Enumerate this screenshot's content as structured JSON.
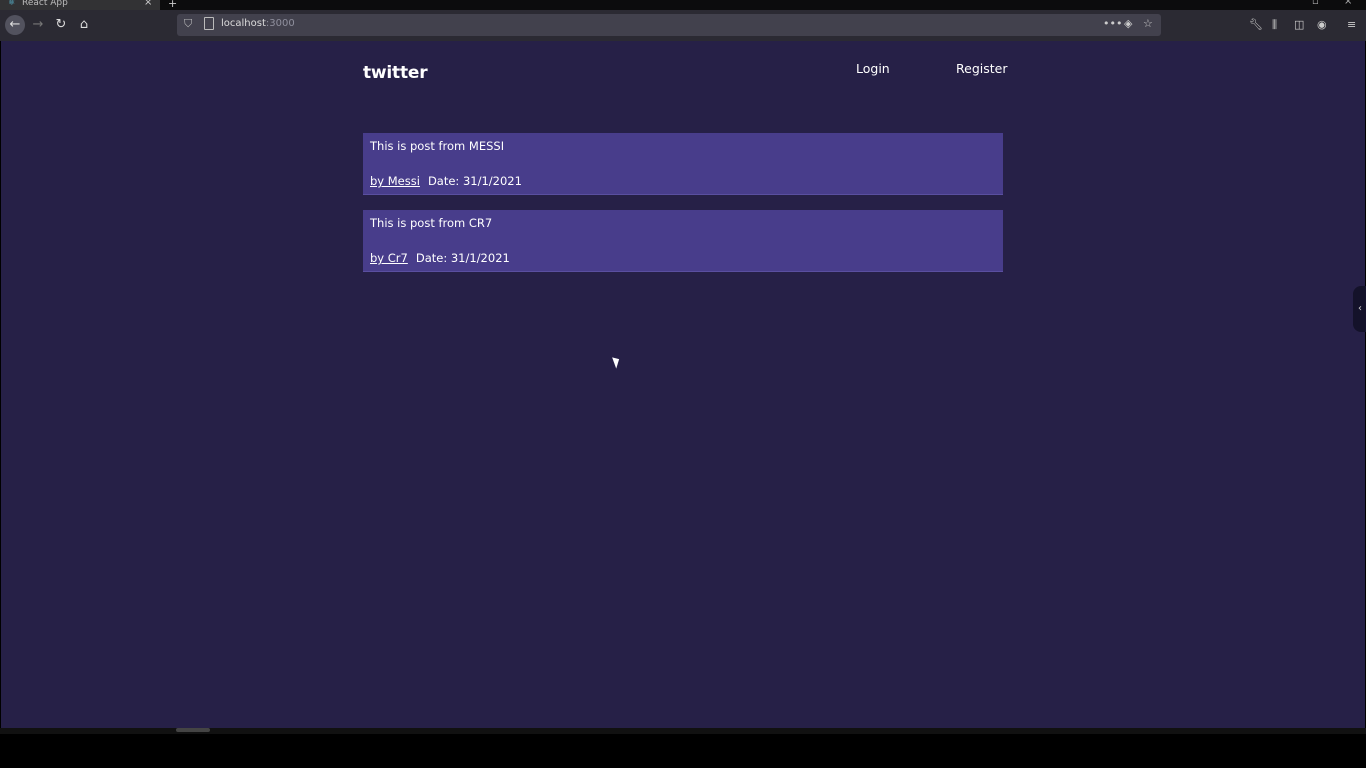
{
  "browser": {
    "tab_title": "React App",
    "url_host": "localhost",
    "url_port": ":3000"
  },
  "app": {
    "logo": "twitter",
    "nav": {
      "login": "Login",
      "register": "Register"
    },
    "posts": [
      {
        "text": "This is post from MESSI",
        "author": "by Messi",
        "date": "Date: 31/1/2021"
      },
      {
        "text": "This is post from CR7",
        "author": "by Cr7",
        "date": "Date: 31/1/2021"
      }
    ]
  },
  "colors": {
    "page_bg": "#262047",
    "post_bg": "#483d8b",
    "text": "#ffffff"
  },
  "icons": {
    "back": "arrow-left-icon",
    "forward": "arrow-right-icon",
    "reload": "reload-icon",
    "home": "home-icon",
    "shield": "shield-icon",
    "page": "page-icon",
    "more": "more-icon",
    "pocket": "pocket-icon",
    "bookmark": "star-icon",
    "tools": "wrench-icon",
    "library": "library-icon",
    "sidebar": "sidebar-icon",
    "account": "account-icon",
    "menu": "hamburger-icon"
  }
}
